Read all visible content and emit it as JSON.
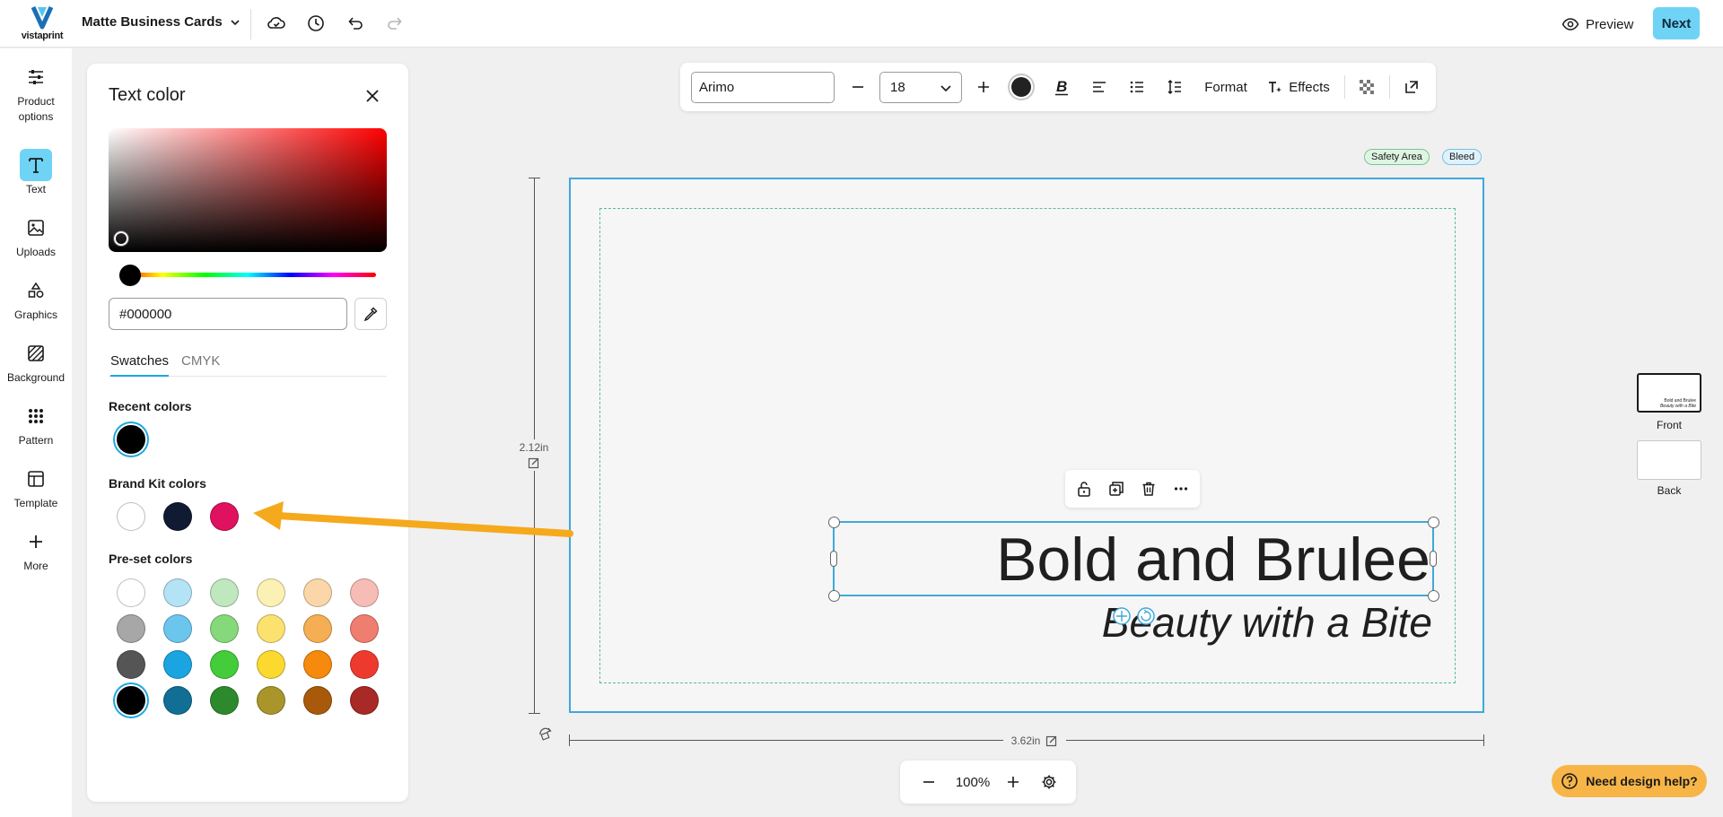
{
  "header": {
    "logo_text": "vistaprint",
    "project_title": "Matte Business Cards",
    "preview_label": "Preview",
    "next_label": "Next"
  },
  "rail": {
    "items": [
      {
        "label": "Product options",
        "icon": "sliders-icon"
      },
      {
        "label": "Text",
        "icon": "text-icon"
      },
      {
        "label": "Uploads",
        "icon": "image-icon"
      },
      {
        "label": "Graphics",
        "icon": "shapes-icon"
      },
      {
        "label": "Background",
        "icon": "hatch-icon"
      },
      {
        "label": "Pattern",
        "icon": "grid-dots-icon"
      },
      {
        "label": "Template",
        "icon": "template-icon"
      },
      {
        "label": "More",
        "icon": "plus-icon"
      }
    ],
    "active": "Text"
  },
  "color_panel": {
    "title": "Text color",
    "hex_value": "#000000",
    "tabs": [
      "Swatches",
      "CMYK"
    ],
    "active_tab": "Swatches",
    "recent_label": "Recent colors",
    "recent_colors": [
      "#000000"
    ],
    "brand_label": "Brand Kit colors",
    "brand_colors": [
      "#ffffff",
      "#111a33",
      "#e0115f"
    ],
    "preset_label": "Pre-set colors",
    "preset_colors": [
      [
        "#ffffff",
        "#b3e3f5",
        "#bfe8bf",
        "#fbf1b4",
        "#fbd6a8",
        "#f7bcb6"
      ],
      [
        "#a7a7a7",
        "#6cc5ec",
        "#86d97a",
        "#fbe26e",
        "#f5ae54",
        "#ef7d70"
      ],
      [
        "#555555",
        "#1ba5e0",
        "#45cc3a",
        "#fbd92f",
        "#f58a0c",
        "#ee3a2e"
      ],
      [
        "#000000",
        "#116f96",
        "#2c8a2c",
        "#a9952a",
        "#a85a0a",
        "#a82925"
      ]
    ],
    "selected_color": "#000000"
  },
  "toolbar": {
    "font": "Arimo",
    "size": "18",
    "format_label": "Format",
    "effects_label": "Effects",
    "current_color": "#222222"
  },
  "canvas": {
    "safety_label": "Safety Area",
    "bleed_label": "Bleed",
    "headline": "Bold and Brulee",
    "tagline": "Beauty with a Bite",
    "height_label": "2.12in",
    "width_label": "3.62in"
  },
  "zoom": {
    "level": "100%"
  },
  "pages": {
    "front_label": "Front",
    "back_label": "Back",
    "thumb_line1": "Bold and Brulee",
    "thumb_line2": "Beauty with a Bite"
  },
  "help": {
    "label": "Need design help?"
  },
  "colors": {
    "accent": "#6fd3f5",
    "selection": "#3fa9da",
    "help": "#f6b546",
    "annotation_arrow": "#f5a91c"
  }
}
